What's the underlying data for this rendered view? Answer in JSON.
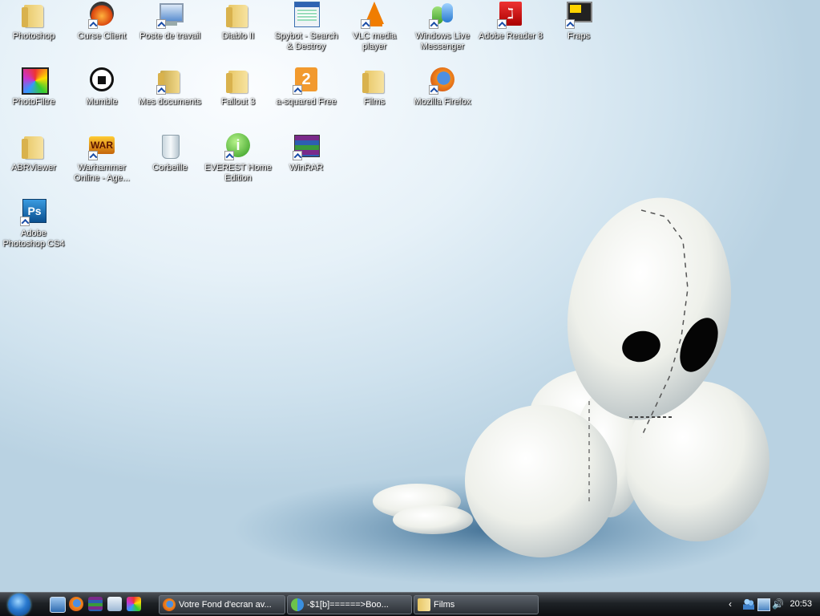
{
  "desktop": {
    "icons": [
      {
        "label": "Photoshop",
        "icon": "folder-icon"
      },
      {
        "label": "Curse Client",
        "icon": "curse-client-icon"
      },
      {
        "label": "Poste de travail",
        "icon": "computer-icon"
      },
      {
        "label": "Diablo II",
        "icon": "folder-icon"
      },
      {
        "label": "Spybot - Search & Destroy",
        "icon": "spybot-icon"
      },
      {
        "label": "VLC media player",
        "icon": "vlc-icon"
      },
      {
        "label": "Windows Live Messenger",
        "icon": "messenger-icon"
      },
      {
        "label": "Adobe Reader 8",
        "icon": "adobe-reader-icon"
      },
      {
        "label": "Fraps",
        "icon": "fraps-icon"
      },
      {
        "label": "PhotoFiltre",
        "icon": "photofiltre-icon"
      },
      {
        "label": "Mumble",
        "icon": "mumble-icon"
      },
      {
        "label": "Mes documents",
        "icon": "documents-icon"
      },
      {
        "label": "Fallout 3",
        "icon": "folder-icon"
      },
      {
        "label": "a-squared Free",
        "icon": "a-squared-icon"
      },
      {
        "label": "Films",
        "icon": "folder-icon"
      },
      {
        "label": "Mozilla Firefox",
        "icon": "firefox-icon"
      },
      {
        "label": "ABRViewer",
        "icon": "folder-icon"
      },
      {
        "label": "Warhammer Online - Age...",
        "icon": "warhammer-icon"
      },
      {
        "label": "Corbeille",
        "icon": "recycle-bin-icon"
      },
      {
        "label": "EVEREST Home Edition",
        "icon": "everest-icon"
      },
      {
        "label": "WinRAR",
        "icon": "winrar-icon"
      },
      {
        "label": "Adobe Photoshop CS4",
        "icon": "photoshop-icon"
      }
    ]
  },
  "taskbar": {
    "start_icon": "windows-start-orb-icon",
    "quick_launch": [
      {
        "icon": "show-desktop-icon"
      },
      {
        "icon": "firefox-icon"
      },
      {
        "icon": "winrar-icon"
      },
      {
        "icon": "search-icon"
      },
      {
        "icon": "photofiltre-icon"
      }
    ],
    "windows": [
      {
        "label": "Votre Fond d'ecran av...",
        "icon": "firefox-icon"
      },
      {
        "label": "-$1[b]======>Boo...",
        "icon": "messenger-icon"
      },
      {
        "label": "Films",
        "icon": "folder-icon"
      }
    ],
    "tray": {
      "icons": [
        "chevron-left-icon",
        "users-icon",
        "network-icon",
        "volume-icon"
      ],
      "clock": "20:53"
    }
  },
  "colors": {
    "taskbar": "#1e2226",
    "desktop_bg": "#e6f1f8",
    "label_text": "#ffffff"
  }
}
